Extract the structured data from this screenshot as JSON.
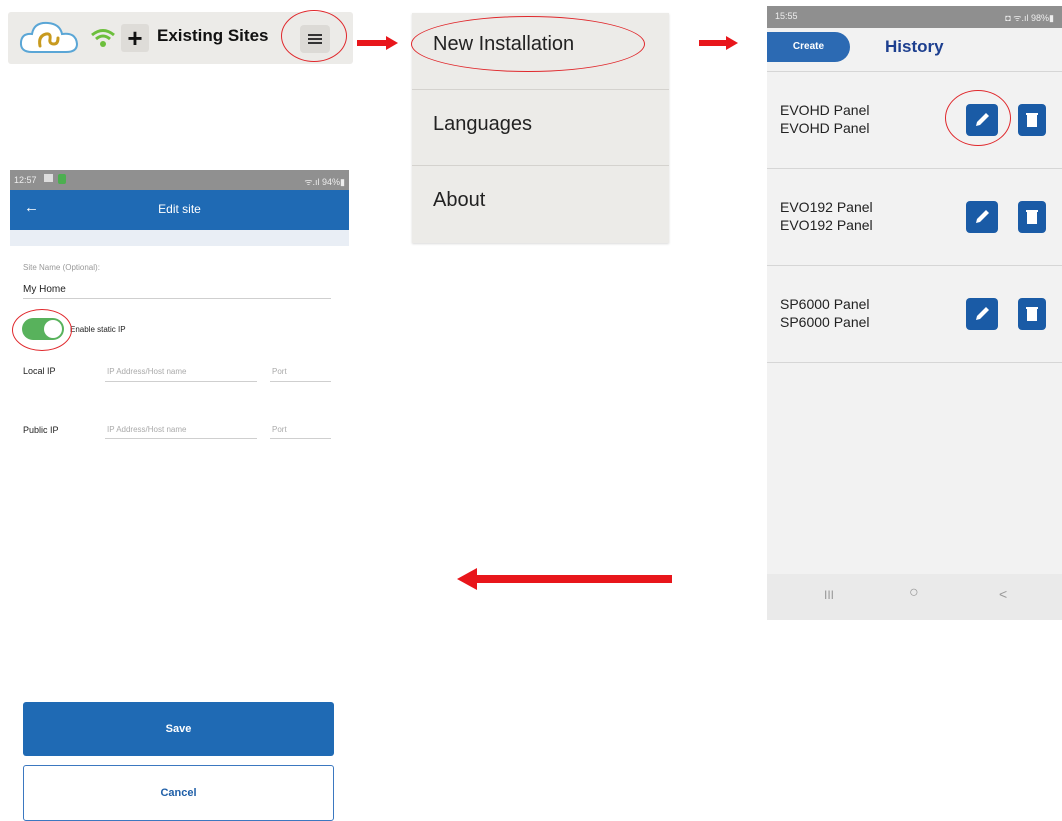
{
  "toolbar": {
    "title": "Existing Sites",
    "icons": [
      "cloud-swan-logo-icon",
      "wifi-icon",
      "plus-icon",
      "hamburger-menu-icon"
    ]
  },
  "menu": {
    "items": [
      {
        "label": "New Installation"
      },
      {
        "label": "Languages"
      },
      {
        "label": "About"
      }
    ]
  },
  "history": {
    "status_time": "15:55",
    "status_right": "◘ ᯤ.ıl 98%▮",
    "create_label": "Create",
    "title": "History",
    "rows": [
      {
        "line1": "EVOHD Panel",
        "line2": "EVOHD Panel"
      },
      {
        "line1": "EVO192 Panel",
        "line2": "EVO192 Panel"
      },
      {
        "line1": "SP6000 Panel",
        "line2": "SP6000 Panel"
      }
    ],
    "nav": {
      "recents": "III",
      "home": "○",
      "back": "<"
    }
  },
  "edit_site": {
    "status_time": "12:57",
    "status_right": "ᯤ.ıl 94%▮",
    "back": "←",
    "title": "Edit site",
    "site_name_label": "Site Name (Optional):",
    "site_name_value": "My Home",
    "static_ip_label": "Enable static IP",
    "static_ip_enabled": true,
    "local_ip_label": "Local IP",
    "public_ip_label": "Public IP",
    "ip_placeholder": "IP Address/Host name",
    "port_placeholder": "Port",
    "save_label": "Save",
    "cancel_label": "Cancel"
  },
  "colors": {
    "accent_blue": "#1f6ab4",
    "annotation_red": "#e8161b",
    "toggle_green": "#58b25c"
  }
}
